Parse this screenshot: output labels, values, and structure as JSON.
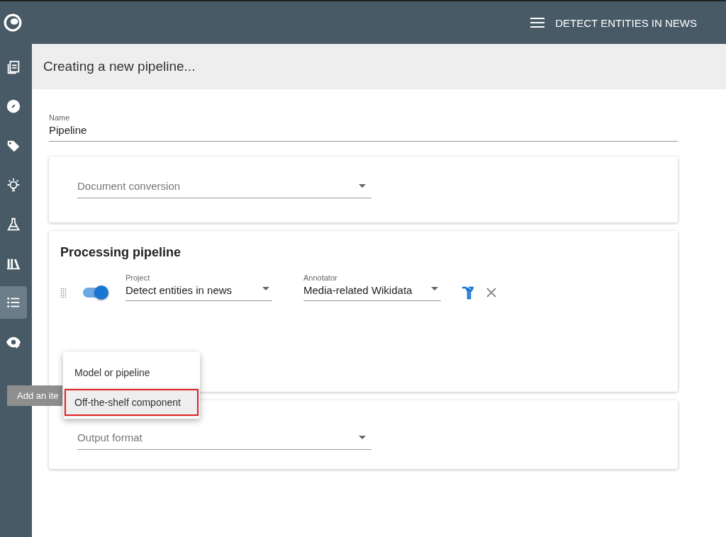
{
  "top_bar": {
    "title": "DETECT ENTITIES IN NEWS"
  },
  "sidebar": {
    "items": [
      {
        "selected": false
      },
      {
        "selected": false
      },
      {
        "selected": false
      },
      {
        "selected": false
      },
      {
        "selected": false
      },
      {
        "selected": false
      },
      {
        "selected": true
      },
      {
        "selected": false
      }
    ]
  },
  "page_header": {
    "title": "Creating a new pipeline..."
  },
  "name_field": {
    "label": "Name",
    "value": "Pipeline"
  },
  "conversion_card": {
    "placeholder": "Document conversion"
  },
  "processing_card": {
    "title": "Processing pipeline",
    "steps": [
      {
        "enabled": true,
        "project": {
          "label": "Project",
          "value": "Detect entities in news"
        },
        "annotator": {
          "label": "Annotator",
          "value": "Media-related Wikidata"
        }
      }
    ]
  },
  "output_card": {
    "placeholder": "Output format"
  },
  "tooltip": {
    "text": "Add an ite"
  },
  "add_menu": {
    "items": [
      {
        "label": "Model or pipeline",
        "selected": false
      },
      {
        "label": "Off-the-shelf component",
        "selected": true
      }
    ]
  }
}
